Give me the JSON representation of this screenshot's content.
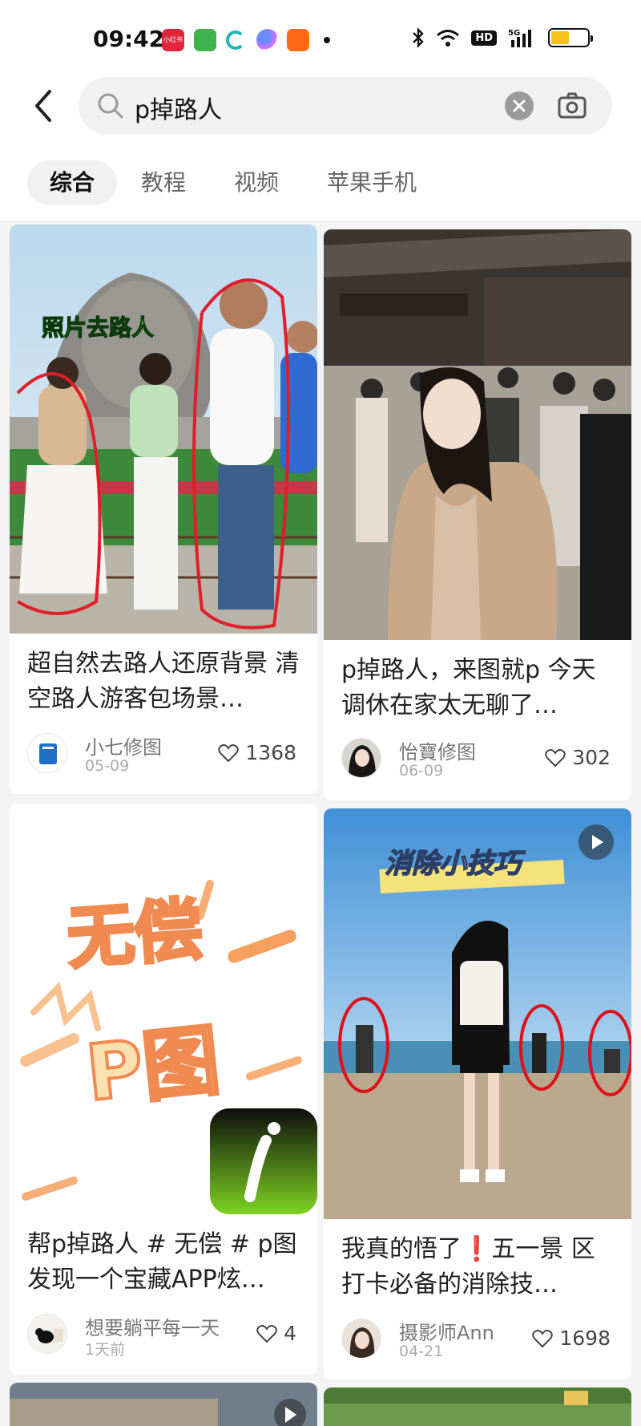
{
  "status_bar": {
    "time": "09:42",
    "network_label": "HD",
    "signal_label": "5G",
    "app_icon_label": "小红书"
  },
  "search": {
    "query": "p掉路人"
  },
  "tabs": [
    {
      "label": "综合",
      "active": true
    },
    {
      "label": "教程",
      "active": false
    },
    {
      "label": "视频",
      "active": false
    },
    {
      "label": "苹果手机",
      "active": false
    }
  ],
  "feed": [
    {
      "title": "超自然去路人还原背景 清空路人游客包场景…",
      "overlay_text": "照片去路人",
      "author": "小七修图",
      "date": "05-09",
      "likes": "1368",
      "is_video": false
    },
    {
      "title": "p掉路人，来图就p 今天调休在家太无聊了…",
      "author": "怡寶修图",
      "date": "06-09",
      "likes": "302",
      "is_video": false
    },
    {
      "title": "帮p掉路人 # 无偿 # p图 发现一个宝藏APP炫…",
      "overlay_line1": "无偿",
      "overlay_line2": "P图",
      "author": "想要躺平每一天",
      "date": "1天前",
      "likes": "4",
      "is_video": false
    },
    {
      "title": "我真的悟了❗️五一景 区打卡必备的消除技…",
      "overlay_text": "消除小技巧",
      "author": "摄影师Ann",
      "date": "04-21",
      "likes": "1698",
      "is_video": true
    }
  ],
  "colors": {
    "accent_red": "#e3243b",
    "tab_active_bg": "#f1f1f1",
    "page_bg": "#f4f4f4"
  }
}
